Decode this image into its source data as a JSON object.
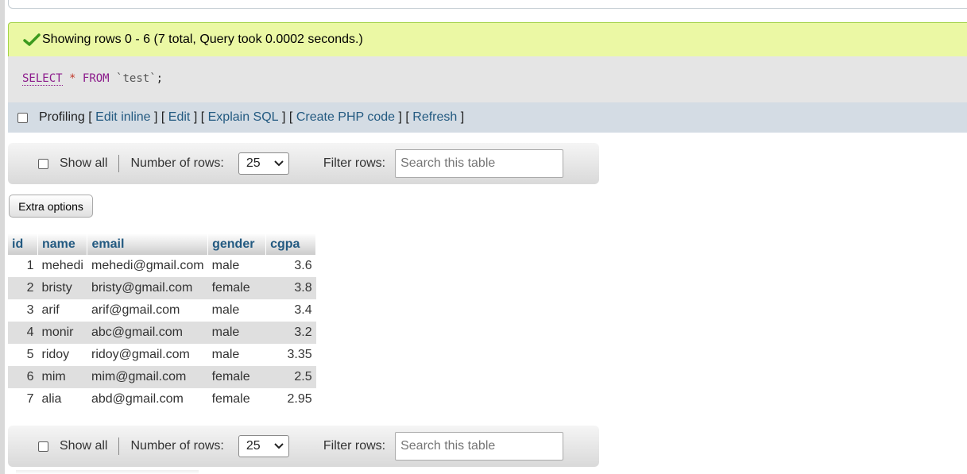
{
  "message": {
    "text": "Showing rows 0 - 6 (7 total, Query took 0.0002 seconds.)"
  },
  "sql": {
    "select": "SELECT",
    "star": "*",
    "from": "FROM",
    "table": "`test`",
    "semicolon": ";"
  },
  "profiling": {
    "label": "Profiling",
    "links": [
      "Edit inline",
      "Edit",
      "Explain SQL",
      "Create PHP code",
      "Refresh"
    ]
  },
  "nav": {
    "show_all": "Show all",
    "rows_label": "Number of rows:",
    "rows_value": "25",
    "filter_label": "Filter rows:",
    "search_placeholder": "Search this table"
  },
  "extra_options": "Extra options",
  "table": {
    "columns": [
      "id",
      "name",
      "email",
      "gender",
      "cgpa"
    ],
    "rows": [
      [
        "1",
        "mehedi",
        "mehedi@gmail.com",
        "male",
        "3.6"
      ],
      [
        "2",
        "bristy",
        "bristy@gmail.com",
        "female",
        "3.8"
      ],
      [
        "3",
        "arif",
        "arif@gmail.com",
        "male",
        "3.4"
      ],
      [
        "4",
        "monir",
        "abc@gmail.com",
        "male",
        "3.2"
      ],
      [
        "5",
        "ridoy",
        "ridoy@gmail.com",
        "male",
        "3.35"
      ],
      [
        "6",
        "mim",
        "mim@gmail.com",
        "female",
        "2.5"
      ],
      [
        "7",
        "alia",
        "abd@gmail.com",
        "female",
        "2.95"
      ]
    ]
  },
  "colors": {
    "success_bg": "#ebf8a4",
    "sql_bg": "#e5e5e5",
    "profiling_bg": "#d4dce4",
    "link": "#235a81",
    "row_alt": "#dfdfdf"
  }
}
